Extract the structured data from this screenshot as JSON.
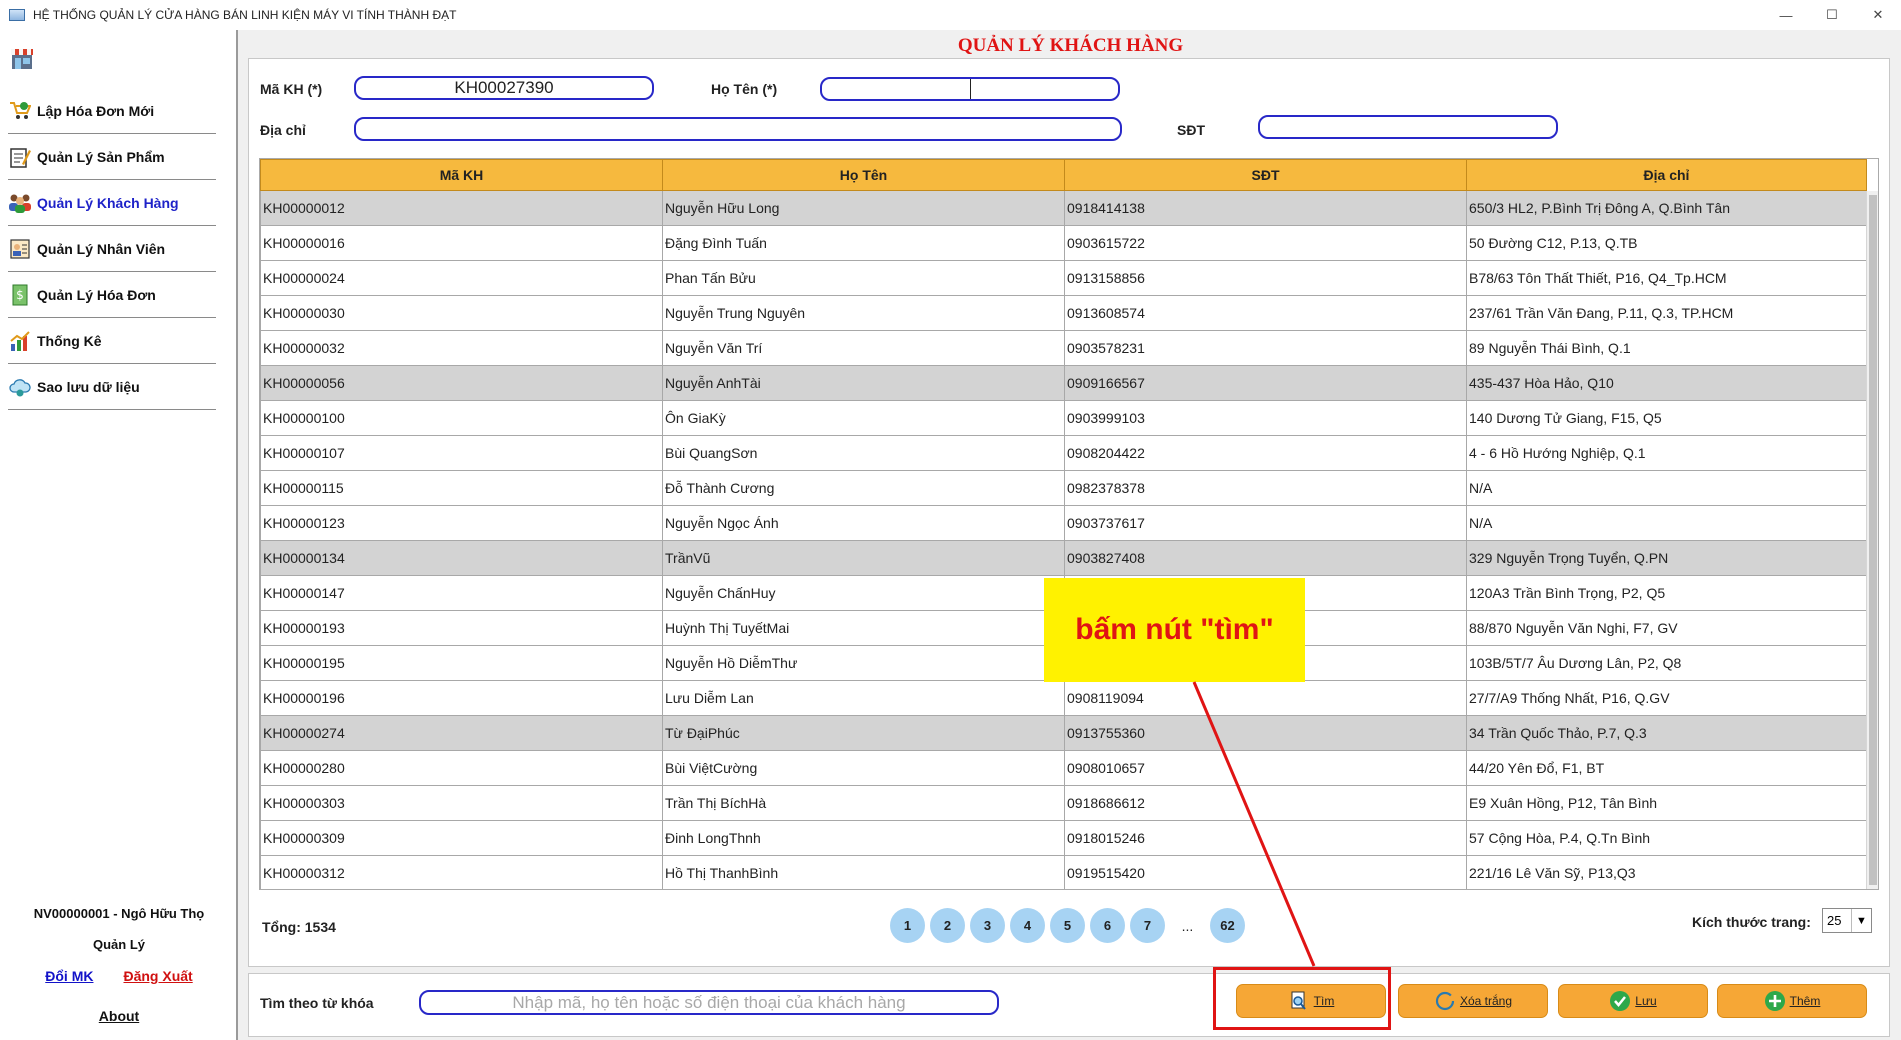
{
  "window": {
    "title": "HỆ THỐNG QUẢN LÝ CỬA HÀNG BÁN LINH KIỆN MÁY VI TÍNH THÀNH ĐẠT",
    "minimize": "—",
    "maximize": "☐",
    "close": "✕"
  },
  "sidebar": {
    "items": [
      {
        "label": "Lập Hóa Đơn Mới",
        "icon": "cart-icon"
      },
      {
        "label": "Quản Lý Sản Phẩm",
        "icon": "notepad-icon"
      },
      {
        "label": "Quản Lý Khách Hàng",
        "icon": "customers-icon"
      },
      {
        "label": "Quản Lý Nhân Viên",
        "icon": "employee-icon"
      },
      {
        "label": "Quản Lý Hóa Đơn",
        "icon": "invoice-icon"
      },
      {
        "label": "Thống Kê",
        "icon": "chart-icon"
      },
      {
        "label": "Sao lưu dữ liệu",
        "icon": "cloud-backup-icon"
      }
    ],
    "active_index": 2,
    "user_name": "NV00000001 - Ngô Hữu  Thọ",
    "user_role": "Quản Lý",
    "change_password": "Đổi MK",
    "logout": "Đăng Xuất",
    "about": "About"
  },
  "main": {
    "title": "QUẢN LÝ KHÁCH HÀNG",
    "form": {
      "ma_kh_label": "Mã KH (*)",
      "ma_kh_value": "KH00027390",
      "ho_ten_label": "Họ Tên (*)",
      "ho_ten_value": "",
      "dia_chi_label": "Địa chỉ",
      "dia_chi_value": "",
      "sdt_label": "SĐT",
      "sdt_value": ""
    },
    "table": {
      "columns": [
        "Mã KH",
        "Họ Tên",
        "SĐT",
        "Địa chỉ"
      ],
      "rows": [
        {
          "ma": "KH00000012",
          "ten": "Nguyễn Hữu Long",
          "sdt": "0918414138",
          "diachi": "650/3 HL2, P.Bình Trị Đông A, Q.Bình Tân",
          "gray": true
        },
        {
          "ma": "KH00000016",
          "ten": "Đặng Đình Tuấn",
          "sdt": "0903615722",
          "diachi": "50 Đường C12, P.13, Q.TB",
          "gray": false
        },
        {
          "ma": "KH00000024",
          "ten": "Phan Tấn Bửu",
          "sdt": "0913158856",
          "diachi": "B78/63 Tôn Thất Thiết, P16, Q4_Tp.HCM",
          "gray": false
        },
        {
          "ma": "KH00000030",
          "ten": "Nguyễn Trung Nguyên",
          "sdt": "0913608574",
          "diachi": "237/61 Trần Văn Đang, P.11, Q.3, TP.HCM",
          "gray": false
        },
        {
          "ma": "KH00000032",
          "ten": "Nguyễn Văn Trí",
          "sdt": "0903578231",
          "diachi": "89 Nguyễn Thái Bình, Q.1",
          "gray": false
        },
        {
          "ma": "KH00000056",
          "ten": "Nguyễn AnhTài",
          "sdt": "0909166567",
          "diachi": "435-437 Hòa Hảo, Q10",
          "gray": true
        },
        {
          "ma": "KH00000100",
          "ten": "Ôn GiaKỳ",
          "sdt": "0903999103",
          "diachi": "140 Dương Tử Giang, F15, Q5",
          "gray": false
        },
        {
          "ma": "KH00000107",
          "ten": "Bùi QuangSơn",
          "sdt": "0908204422",
          "diachi": "4 - 6 Hồ Hướng Nghiệp, Q.1",
          "gray": false
        },
        {
          "ma": "KH00000115",
          "ten": "Đỗ Thành Cương",
          "sdt": "0982378378",
          "diachi": "N/A",
          "gray": false
        },
        {
          "ma": "KH00000123",
          "ten": "Nguyễn Ngọc Ánh",
          "sdt": "0903737617",
          "diachi": "N/A",
          "gray": false
        },
        {
          "ma": "KH00000134",
          "ten": "TrầnVũ",
          "sdt": "0903827408",
          "diachi": "329 Nguyễn Trọng Tuyển, Q.PN",
          "gray": true
        },
        {
          "ma": "KH00000147",
          "ten": "Nguyễn ChấnHuy",
          "sdt": "",
          "diachi": "120A3 Trần Bình Trọng, P2, Q5",
          "gray": false
        },
        {
          "ma": "KH00000193",
          "ten": "Huỳnh Thị TuyếtMai",
          "sdt": "",
          "diachi": "88/870 Nguyễn Văn Nghi, F7, GV",
          "gray": false
        },
        {
          "ma": "KH00000195",
          "ten": "Nguyễn Hồ DiễmThư",
          "sdt": "",
          "diachi": "103B/5T/7 Âu Dương Lân, P2, Q8",
          "gray": false
        },
        {
          "ma": "KH00000196",
          "ten": "Lưu Diễm Lan",
          "sdt": "0908119094",
          "diachi": "27/7/A9 Thống Nhất, P16, Q.GV",
          "gray": false
        },
        {
          "ma": "KH00000274",
          "ten": "Từ ĐạiPhúc",
          "sdt": "0913755360",
          "diachi": "34 Trần Quốc Thảo, P.7, Q.3",
          "gray": true
        },
        {
          "ma": "KH00000280",
          "ten": "Bùi ViệtCường",
          "sdt": "0908010657",
          "diachi": "44/20 Yên Đổ, F1, BT",
          "gray": false
        },
        {
          "ma": "KH00000303",
          "ten": "Trần Thị BíchHà",
          "sdt": "0918686612",
          "diachi": "E9 Xuân Hồng, P12, Tân Bình",
          "gray": false
        },
        {
          "ma": "KH00000309",
          "ten": "Đinh LongThnh",
          "sdt": "0918015246",
          "diachi": "57 Cộng Hòa, P.4, Q.Tn Bình",
          "gray": false
        },
        {
          "ma": "KH00000312",
          "ten": "Hồ Thị ThanhBình",
          "sdt": "0919515420",
          "diachi": "221/16 Lê Văn Sỹ, P13,Q3",
          "gray": false
        }
      ]
    },
    "total": "Tổng: 1534",
    "pages": [
      "1",
      "2",
      "3",
      "4",
      "5",
      "6",
      "7"
    ],
    "page_ellipsis": "...",
    "last_page": "62",
    "page_size_label": "Kích thước trang:",
    "page_size_value": "25"
  },
  "search": {
    "label": "Tìm theo từ khóa",
    "placeholder": "Nhập mã, họ tên hoặc số điện thoại của khách hàng",
    "value": ""
  },
  "actions": {
    "find": "Tìm",
    "clear": "Xóa trắng",
    "save": "Lưu",
    "add": "Thêm"
  },
  "annotation": {
    "text": "bấm nút \"tìm\"",
    "color": "#e01414",
    "background": "#fff200"
  },
  "colors": {
    "header": "#f6b93e",
    "button": "#f6a736",
    "page_button": "#a7d3f3",
    "input_border": "#2828c8",
    "title_red": "#e01414"
  }
}
